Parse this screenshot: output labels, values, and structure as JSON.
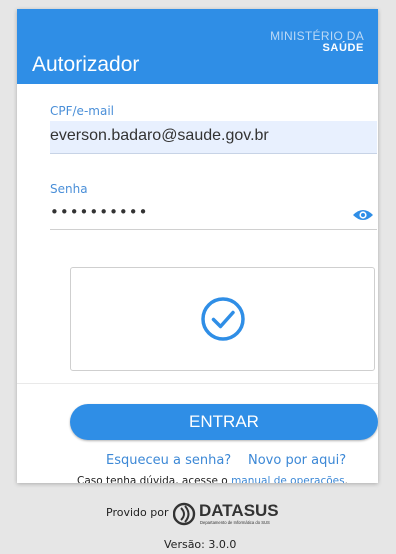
{
  "header": {
    "app_title": "Autorizador",
    "ministry_line1": "MINISTÉRIO DA",
    "ministry_line2": "SAÚDE"
  },
  "form": {
    "email_label": "CPF/e-mail",
    "email_value": "everson.badaro@saude.gov.br",
    "password_label": "Senha",
    "password_value": "••••••••••",
    "enter_label": "ENTRAR"
  },
  "links": {
    "forgot": "Esqueceu a senha?",
    "new_here": "Novo por aqui?",
    "help_prefix": "Caso tenha dúvida, acesse o",
    "help_link": "manual de operações",
    "help_suffix": "."
  },
  "footer": {
    "provided_by": "Provido por",
    "logo_name": "DATASUS",
    "logo_sub": "Departamento de Informática do SUS",
    "version": "Versão: 3.0.0"
  },
  "colors": {
    "primary": "#2f8ee6",
    "link": "#3c88d6",
    "background": "#e6e6e6"
  },
  "icons": {
    "password_toggle": "eye-icon",
    "captcha_status": "check-circle-icon"
  }
}
